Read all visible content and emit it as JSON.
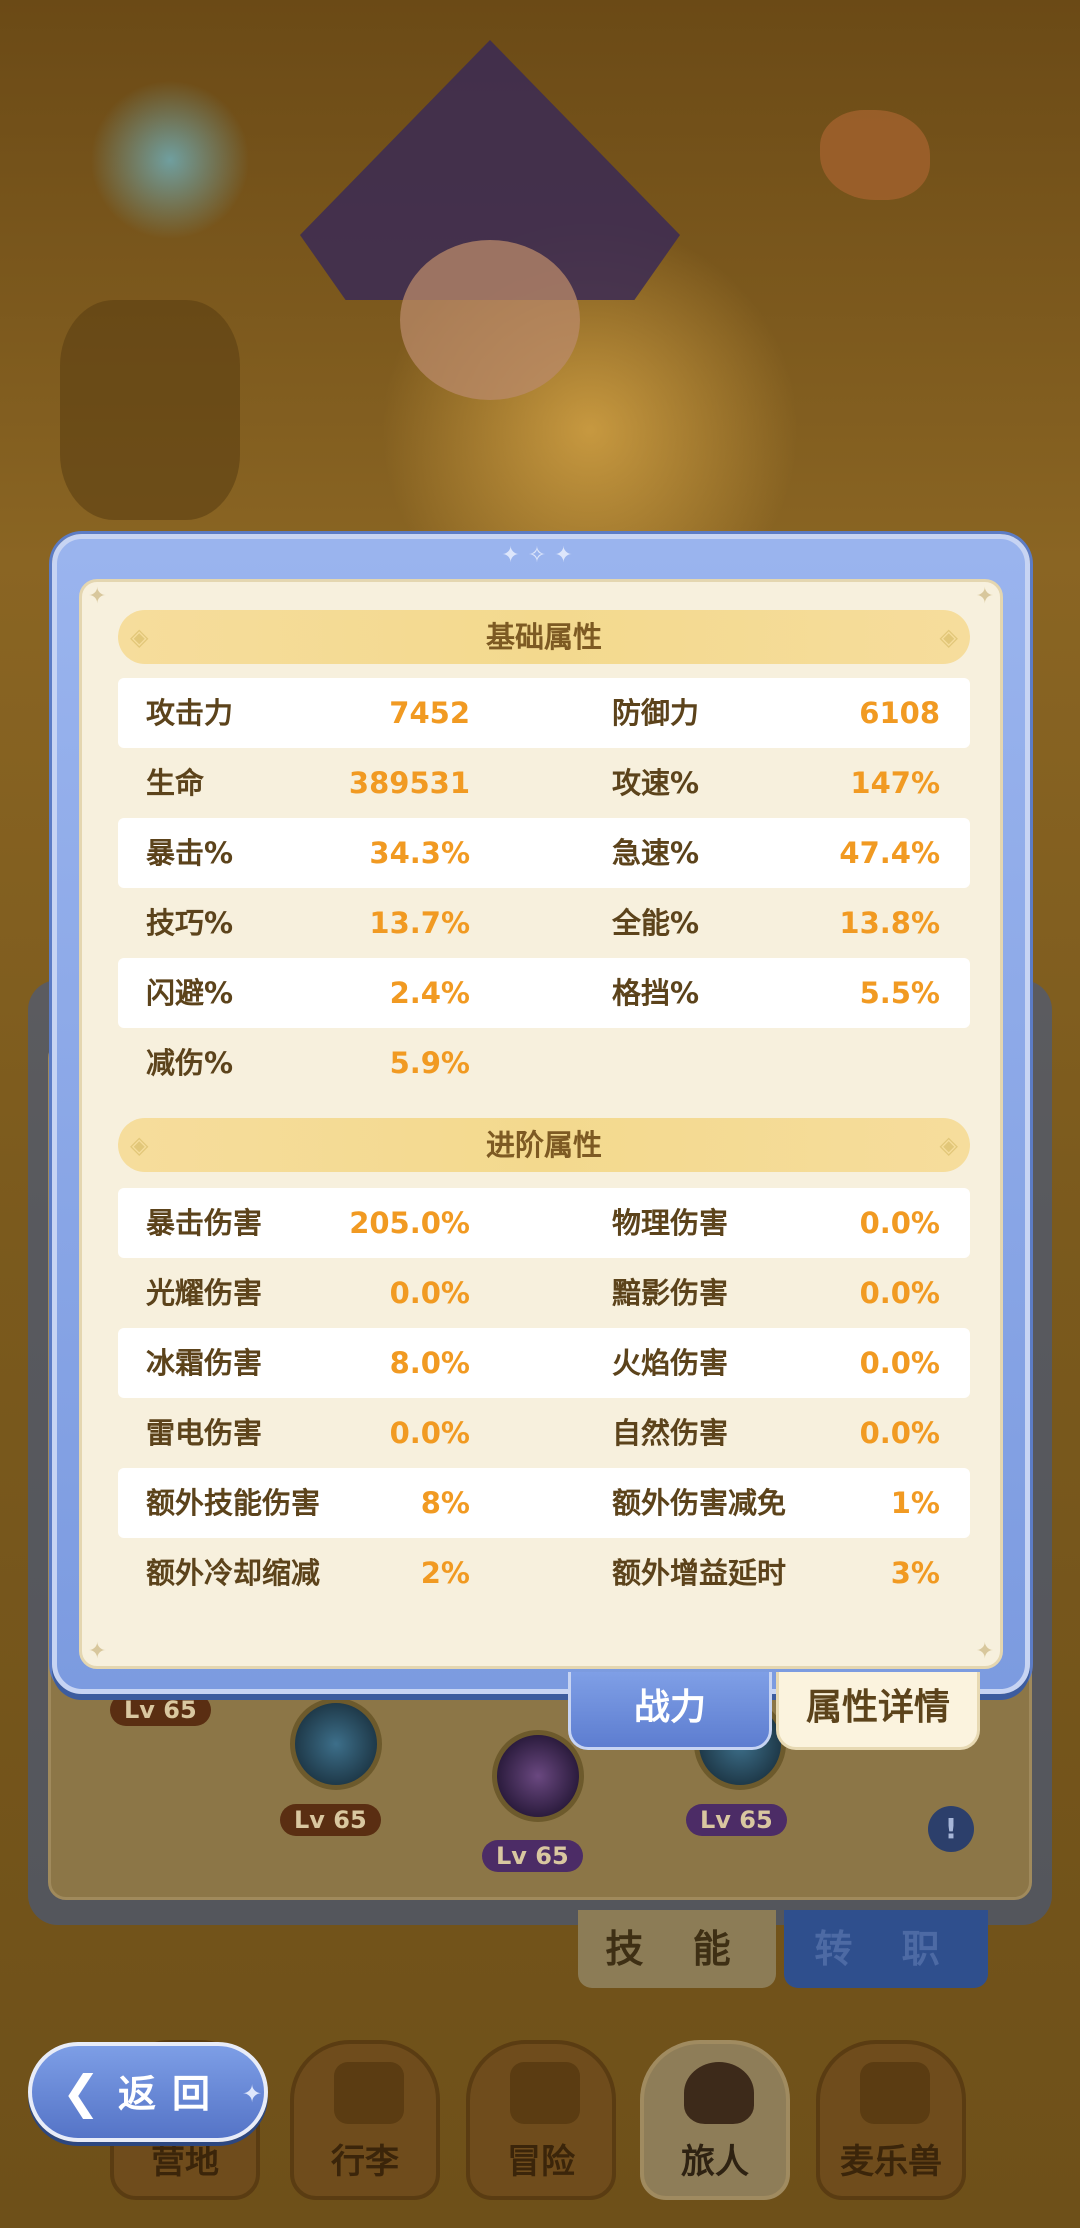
{
  "basic_section": {
    "title": "基础属性",
    "rows": [
      [
        {
          "label": "攻击力",
          "value": "7452"
        },
        {
          "label": "防御力",
          "value": "6108"
        }
      ],
      [
        {
          "label": "生命",
          "value": "389531"
        },
        {
          "label": "攻速%",
          "value": "147%"
        }
      ],
      [
        {
          "label": "暴击%",
          "value": "34.3%"
        },
        {
          "label": "急速%",
          "value": "47.4%"
        }
      ],
      [
        {
          "label": "技巧%",
          "value": "13.7%"
        },
        {
          "label": "全能%",
          "value": "13.8%"
        }
      ],
      [
        {
          "label": "闪避%",
          "value": "2.4%"
        },
        {
          "label": "格挡%",
          "value": "5.5%"
        }
      ],
      [
        {
          "label": "减伤%",
          "value": "5.9%"
        }
      ]
    ]
  },
  "advanced_section": {
    "title": "进阶属性",
    "rows": [
      [
        {
          "label": "暴击伤害",
          "value": "205.0%"
        },
        {
          "label": "物理伤害",
          "value": "0.0%"
        }
      ],
      [
        {
          "label": "光耀伤害",
          "value": "0.0%"
        },
        {
          "label": "黯影伤害",
          "value": "0.0%"
        }
      ],
      [
        {
          "label": "冰霜伤害",
          "value": "8.0%"
        },
        {
          "label": "火焰伤害",
          "value": "0.0%"
        }
      ],
      [
        {
          "label": "雷电伤害",
          "value": "0.0%"
        },
        {
          "label": "自然伤害",
          "value": "0.0%"
        }
      ],
      [
        {
          "label": "额外技能伤害",
          "value": "8%"
        },
        {
          "label": "额外伤害减免",
          "value": "1%"
        }
      ],
      [
        {
          "label": "额外冷却缩减",
          "value": "2%"
        },
        {
          "label": "额外增益延时",
          "value": "3%"
        }
      ]
    ]
  },
  "popup_tabs": {
    "power": "战力",
    "detail": "属性详情"
  },
  "skill_tree": {
    "levels": [
      "Lv 65",
      "Lv 65",
      "Lv 65",
      "Lv 65"
    ]
  },
  "lower_tabs": {
    "skill": "技 能",
    "job": "转 职"
  },
  "back_button": {
    "label": "返回"
  },
  "bottom_nav": [
    "营地",
    "行李",
    "冒险",
    "旅人",
    "麦乐兽"
  ],
  "colors": {
    "value": "#f19a22",
    "label": "#5c431b",
    "header": "#7d5a23",
    "frame": "#7c9be0"
  }
}
